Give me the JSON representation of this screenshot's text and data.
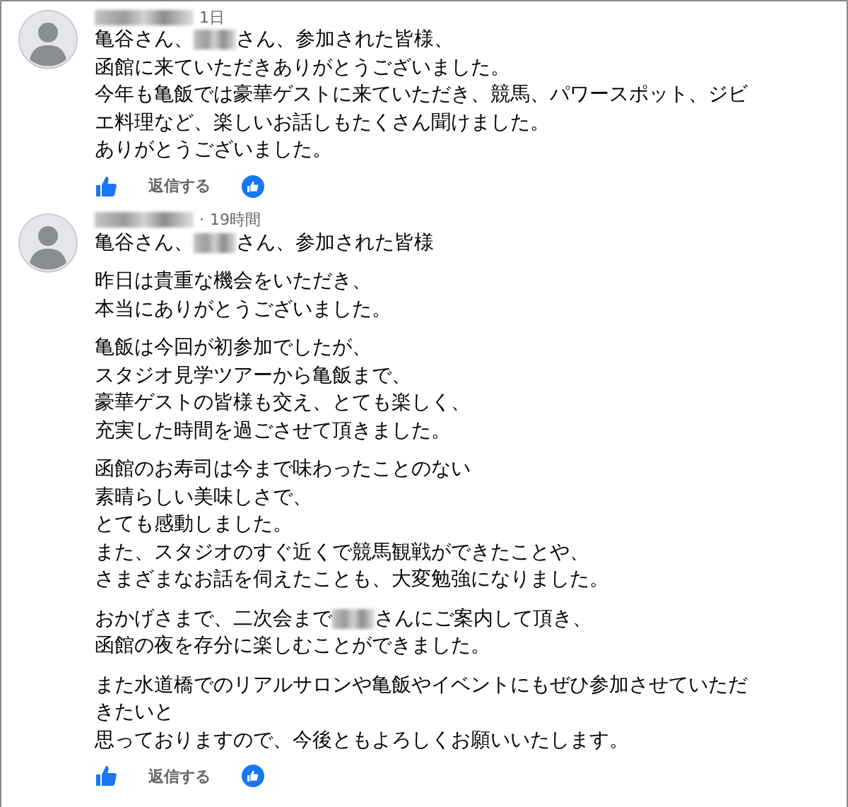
{
  "comments": [
    {
      "time": "1日",
      "paragraphs": [
        [
          [
            {
              "kind": "text",
              "text": "亀谷さん、"
            },
            {
              "kind": "redacted"
            },
            {
              "kind": "text",
              "text": "さん、参加された皆様、"
            }
          ],
          [
            {
              "kind": "text",
              "text": "函館に来ていただきありがとうございました。"
            }
          ],
          [
            {
              "kind": "text",
              "text": "今年も亀飯では豪華ゲストに来ていただき、競馬、パワースポット、ジビ"
            }
          ],
          [
            {
              "kind": "text",
              "text": "エ料理など、楽しいお話しもたくさん聞けました。"
            }
          ],
          [
            {
              "kind": "text",
              "text": "ありがとうございました。"
            }
          ]
        ]
      ],
      "reply_label": "返信する"
    },
    {
      "time": "19時間",
      "time_prefix": "·",
      "paragraphs": [
        [
          [
            {
              "kind": "text",
              "text": "亀谷さん、"
            },
            {
              "kind": "redacted"
            },
            {
              "kind": "text",
              "text": "さん、参加された皆様"
            }
          ]
        ],
        [
          [
            {
              "kind": "text",
              "text": "昨日は貴重な機会をいただき、"
            }
          ],
          [
            {
              "kind": "text",
              "text": "本当にありがとうございました。"
            }
          ]
        ],
        [
          [
            {
              "kind": "text",
              "text": "亀飯は今回が初参加でしたが、"
            }
          ],
          [
            {
              "kind": "text",
              "text": "スタジオ見学ツアーから亀飯まで、"
            }
          ],
          [
            {
              "kind": "text",
              "text": "豪華ゲストの皆様も交え、とても楽しく、"
            }
          ],
          [
            {
              "kind": "text",
              "text": "充実した時間を過ごさせて頂きました。"
            }
          ]
        ],
        [
          [
            {
              "kind": "text",
              "text": "函館のお寿司は今まで味わったことのない"
            }
          ],
          [
            {
              "kind": "text",
              "text": "素晴らしい美味しさで、"
            }
          ],
          [
            {
              "kind": "text",
              "text": "とても感動しました。"
            }
          ],
          [
            {
              "kind": "text",
              "text": "また、スタジオのすぐ近くで競馬観戦ができたことや、"
            }
          ],
          [
            {
              "kind": "text",
              "text": "さまざまなお話を伺えたことも、大変勉強になりました。"
            }
          ]
        ],
        [
          [
            {
              "kind": "text",
              "text": "おかげさまで、二次会まで"
            },
            {
              "kind": "redacted"
            },
            {
              "kind": "text",
              "text": "さんにご案内して頂き、"
            }
          ],
          [
            {
              "kind": "text",
              "text": "函館の夜を存分に楽しむことができました。"
            }
          ]
        ],
        [
          [
            {
              "kind": "text",
              "text": "また水道橋でのリアルサロンや亀飯やイベントにもぜひ参加させていただ"
            }
          ],
          [
            {
              "kind": "text",
              "text": "きたいと"
            }
          ],
          [
            {
              "kind": "text",
              "text": "思っておりますので、今後ともよろしくお願いいたします。"
            }
          ]
        ]
      ],
      "reply_label": "返信する"
    }
  ]
}
